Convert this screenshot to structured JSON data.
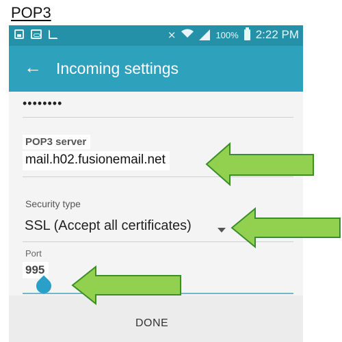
{
  "caption": "POP3",
  "status_bar": {
    "battery": "100%",
    "time": "2:22 PM",
    "icons": [
      "gallery-icon",
      "voicemail-icon",
      "download-icon",
      "mute-icon",
      "wifi-icon",
      "signal-icon",
      "battery-icon"
    ]
  },
  "app_bar": {
    "back_icon": "arrow-back-icon",
    "title": "Incoming settings"
  },
  "password": {
    "value": "••••••••"
  },
  "pop3_server": {
    "label": "POP3 server",
    "value": "mail.h02.fusionemail.net"
  },
  "security_type": {
    "label": "Security type",
    "value": "SSL (Accept all certificates)",
    "icon": "dropdown-icon"
  },
  "port": {
    "label": "Port",
    "value": "995"
  },
  "done_button": {
    "label": "DONE"
  },
  "colors": {
    "status_bar": "#2591a9",
    "app_bar": "#2ea1bc",
    "arrow_fill": "#92d050",
    "arrow_stroke": "#3b8c2a",
    "handle": "#2a9fc8"
  }
}
